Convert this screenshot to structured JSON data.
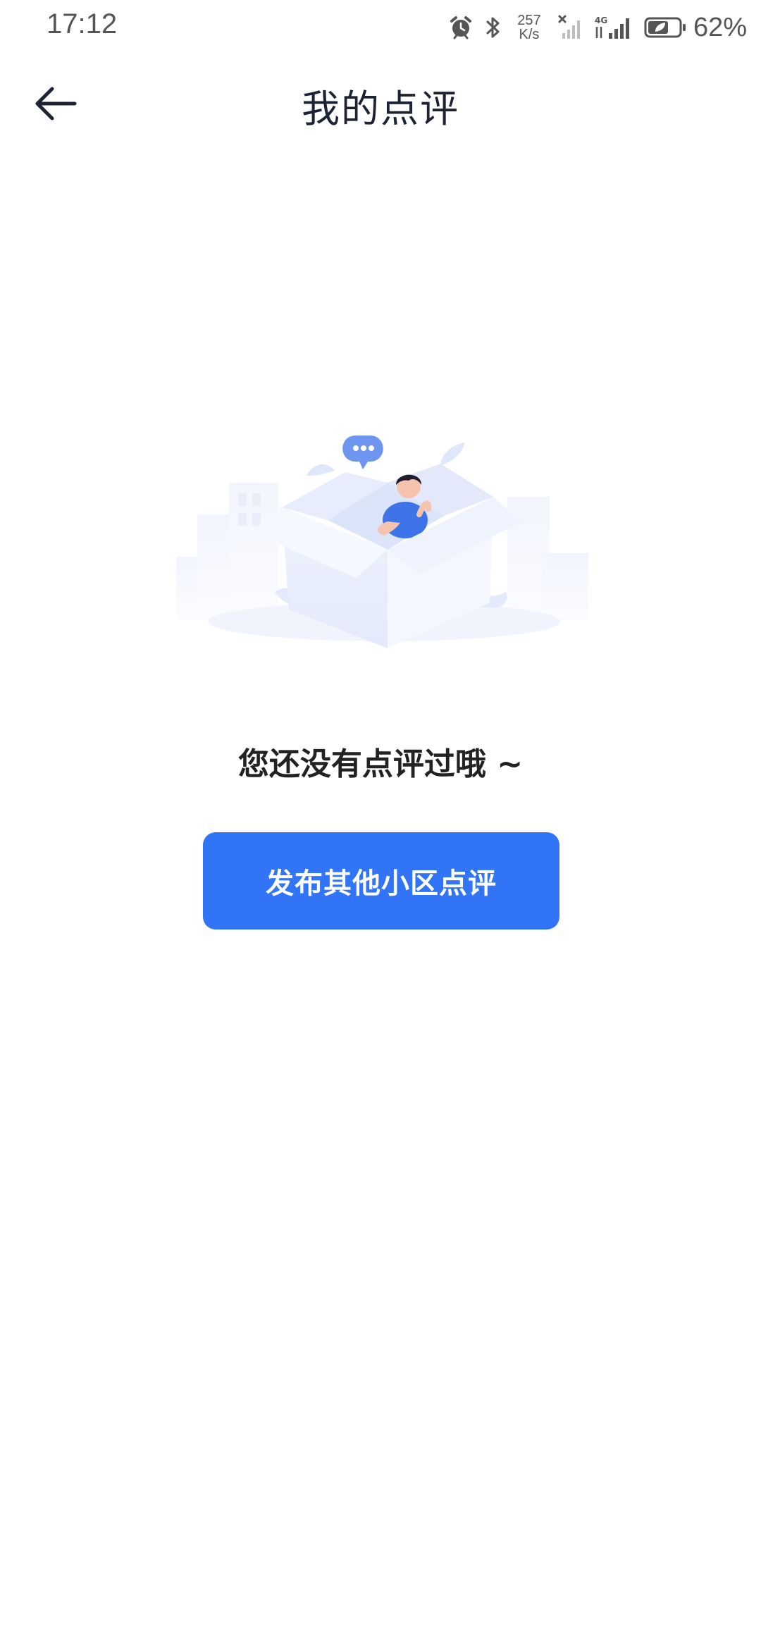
{
  "status_bar": {
    "time": "17:12",
    "net_speed_value": "257",
    "net_speed_unit": "K/s",
    "network_label": "4G",
    "battery_percent": "62%",
    "icons": [
      "alarm-icon",
      "bluetooth-icon",
      "signal-no-sim-icon",
      "signal-4g-icon",
      "battery-saver-icon"
    ]
  },
  "nav": {
    "title": "我的点评",
    "back_icon": "arrow-left-icon"
  },
  "empty_state": {
    "illustration": "empty-box-person-illustration",
    "message": "您还没有点评过哦 ~",
    "button_label": "发布其他小区点评"
  },
  "colors": {
    "primary": "#3274f6",
    "title_text": "#1c2333",
    "message_text": "#222222",
    "status_text": "#555555",
    "background": "#ffffff"
  }
}
